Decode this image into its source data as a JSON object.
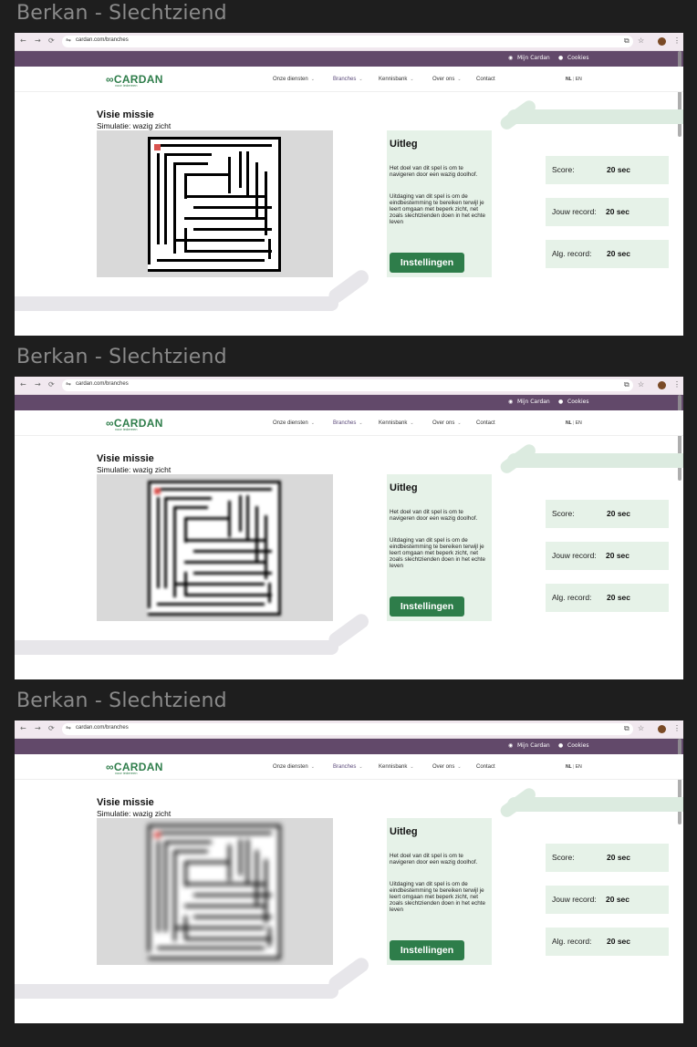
{
  "frame_title": "Berkan - Slechtziend",
  "browser": {
    "url": "cardan.com/branches"
  },
  "topbar": {
    "account": "Mijn Cardan",
    "cookies": "Cookies"
  },
  "site": {
    "brand": "CARDAN",
    "tagline": "voor iedereen",
    "menu": [
      {
        "label": "Onze diensten"
      },
      {
        "label": "Branches"
      },
      {
        "label": "Kennisbank"
      },
      {
        "label": "Over ons"
      },
      {
        "label": "Contact"
      }
    ],
    "lang_active": "NL",
    "lang_sep": "|",
    "lang_other": "EN"
  },
  "content": {
    "title": "Visie missie",
    "subtitle": "Simulatie: wazig zicht",
    "uitleg_title": "Uitleg",
    "uitleg_p1": "Het doel van dit spel is om te navigeren door een wazig doolhof.",
    "uitleg_p2": "Uitdaging van dit spel is om de eindbestemming te bereiken terwijl je leert omgaan met beperk zicht, net zoals slechtzienden doen in het echte leven",
    "settings_button": "Instellingen",
    "stats": [
      {
        "label": "Score:",
        "value": "20 sec"
      },
      {
        "label": "Jouw record:",
        "value": "20 sec"
      },
      {
        "label": "Alg. record:",
        "value": "20 sec"
      }
    ]
  },
  "colors": {
    "topbar": "#62496a",
    "brand_green": "#2e7d4a",
    "panel_green": "#e6f2e8",
    "player": "#d9534f"
  },
  "icons": [
    "back-icon",
    "forward-icon",
    "reload-icon",
    "site-settings-icon",
    "translate-icon",
    "star-icon",
    "profile-icon",
    "menu-dots-icon",
    "user-icon",
    "cookie-icon",
    "chevron-down-icon",
    "logo-link-icon"
  ]
}
